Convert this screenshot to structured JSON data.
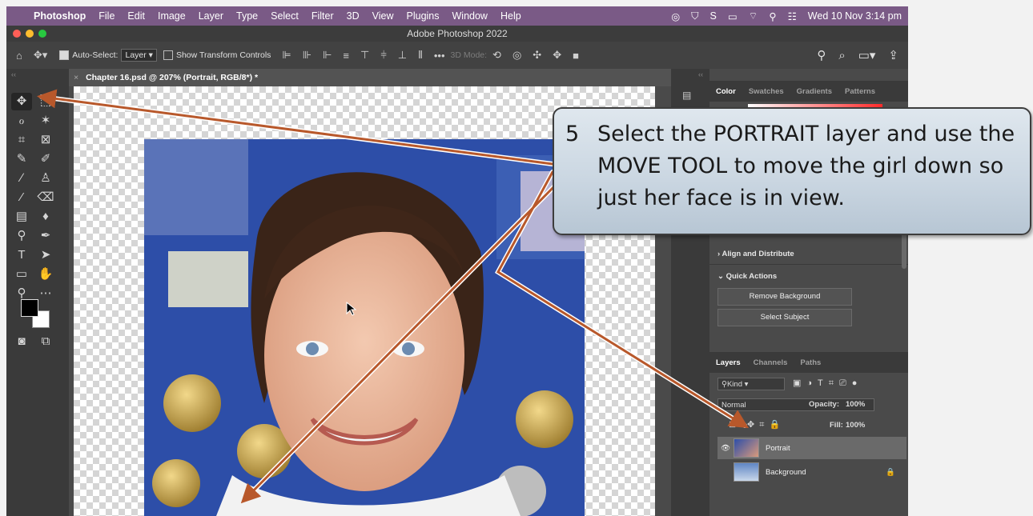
{
  "menubar": {
    "app_name": "Photoshop",
    "items": [
      "File",
      "Edit",
      "Image",
      "Layer",
      "Type",
      "Select",
      "Filter",
      "3D",
      "View",
      "Plugins",
      "Window",
      "Help"
    ],
    "clock": "Wed 10 Nov  3:14 pm"
  },
  "window": {
    "title": "Adobe Photoshop 2022"
  },
  "options_bar": {
    "auto_select_label": "Auto-Select:",
    "auto_select_value": "Layer",
    "show_transform_label": "Show Transform Controls",
    "mode_3d_label": "3D Mode:"
  },
  "document": {
    "tab_title": "Chapter 16.psd @ 207% (Portrait, RGB/8*) *"
  },
  "color_panel": {
    "tabs": [
      "Color",
      "Swatches",
      "Gradients",
      "Patterns"
    ]
  },
  "properties": {
    "align_section": "Align and Distribute",
    "quick_actions_section": "Quick Actions",
    "remove_background_label": "Remove Background",
    "select_subject_label": "Select Subject"
  },
  "layers_panel": {
    "tabs": [
      "Layers",
      "Channels",
      "Paths"
    ],
    "filter_label": "Kind",
    "blend_mode": "Normal",
    "opacity_label": "Opacity:",
    "opacity_value": "100%",
    "fill_label": "Fill:",
    "fill_value": "100%",
    "layers": [
      {
        "name": "Portrait",
        "selected": true
      },
      {
        "name": "Background",
        "locked": true
      }
    ]
  },
  "callout": {
    "step_number": "5",
    "text": "Select the PORTRAIT layer and use the MOVE TOOL to move the girl down so just her face is in view."
  },
  "colors": {
    "menubar": "#7a5a86",
    "arrow": "#b8582b",
    "panel": "#4a4a4a"
  }
}
